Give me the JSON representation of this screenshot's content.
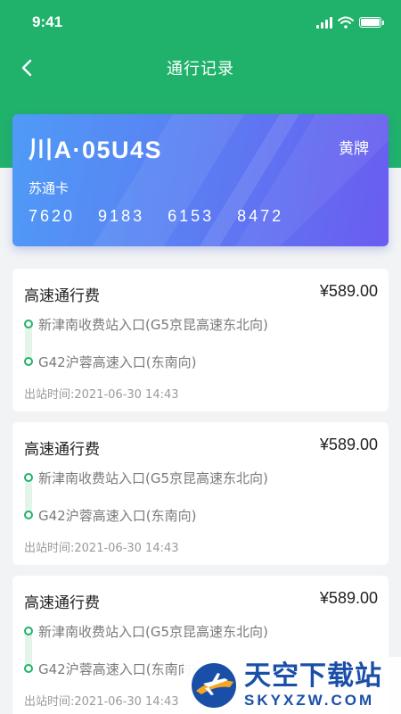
{
  "status_bar": {
    "time": "9:41"
  },
  "nav": {
    "title": "通行记录",
    "back_icon": "chevron-left-icon"
  },
  "plate_card": {
    "plate_number": "川A·05U4S",
    "plate_type": "黄牌",
    "card_type": "苏通卡",
    "card_number": "7620 9183 6153 8472"
  },
  "records": [
    {
      "title": "高速通行费",
      "amount": "¥589.00",
      "entry": "新津南收费站入口(G5京昆高速东北向)",
      "exit": "G42沪蓉高速入口(东南向)",
      "exit_time": "出站时间:2021-06-30 14:43"
    },
    {
      "title": "高速通行费",
      "amount": "¥589.00",
      "entry": "新津南收费站入口(G5京昆高速东北向)",
      "exit": "G42沪蓉高速入口(东南向)",
      "exit_time": "出站时间:2021-06-30 14:43"
    },
    {
      "title": "高速通行费",
      "amount": "¥589.00",
      "entry": "新津南收费站入口(G5京昆高速东北向)",
      "exit": "G42沪蓉高速入口(东南向)",
      "exit_time": "出站时间:2021-06-30 14:43"
    }
  ],
  "watermark": {
    "title": "天空下载站",
    "site": "SKYXZW.COM"
  },
  "colors": {
    "header_green": "#20b26b",
    "card_gradient_start": "#4f9bf6",
    "card_gradient_end": "#6a5cf0",
    "route_dot": "#20b26b"
  }
}
